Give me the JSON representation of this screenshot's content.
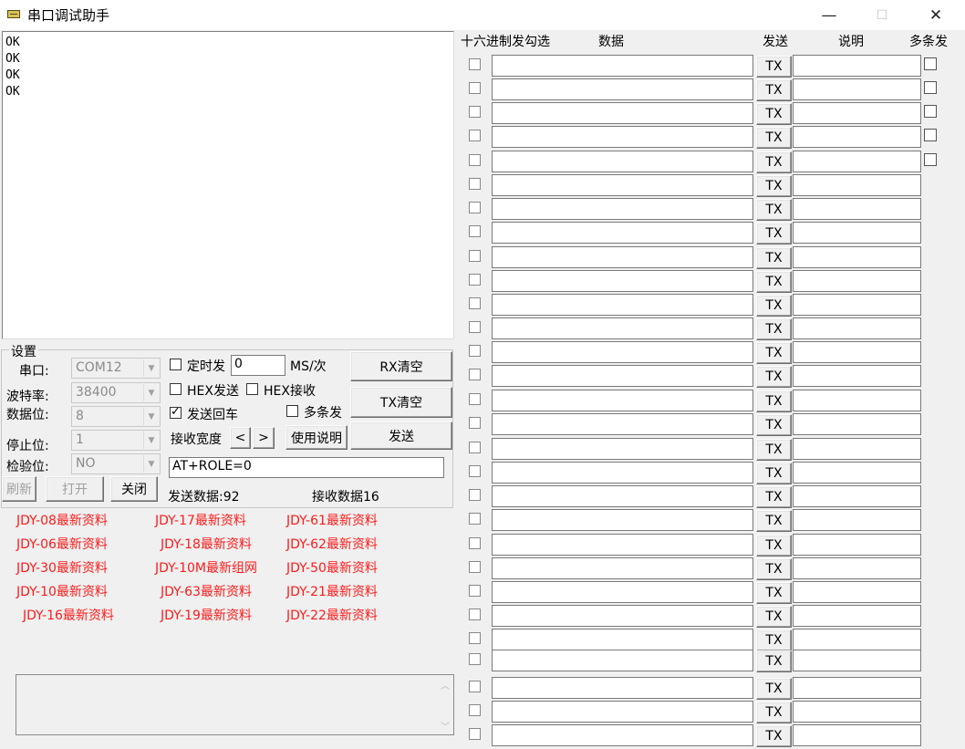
{
  "window": {
    "title": "串口调试助手",
    "minimize": "—",
    "maximize": "☐",
    "close": "✕"
  },
  "receive": {
    "text": "OK\nOK\nOK\nOK"
  },
  "settings": {
    "group_title": "设置",
    "port_label": "串口:",
    "port_value": "COM12",
    "baud_label": "波特率:",
    "baud_value": "38400",
    "databits_label": "数据位:",
    "databits_value": "8",
    "stopbits_label": "停止位:",
    "stopbits_value": "1",
    "parity_label": "检验位:",
    "parity_value": "NO",
    "timed_send_label": "定时发",
    "timed_send_value": "0",
    "interval_unit": "MS/次",
    "hex_send_label": "HEX发送",
    "hex_recv_label": "HEX接收",
    "send_newline_label": "发送回车",
    "multi_send_label": "多条发",
    "recv_width_label": "接收宽度",
    "prev_label": "<",
    "next_label": ">",
    "help_button": "使用说明",
    "rx_clear_button": "RX清空",
    "tx_clear_button": "TX清空",
    "send_button": "发送",
    "refresh_button": "刷新",
    "open_button": "打开",
    "close_button": "关闭",
    "send_input_value": "AT+ROLE=0",
    "sent_count": "发送数据:92",
    "recv_count": "接收数据16"
  },
  "links": [
    [
      "JDY-08最新资料",
      "JDY-17最新资料",
      "JDY-61最新资料"
    ],
    [
      "JDY-06最新资料",
      "JDY-18最新资料",
      "JDY-62最新资料"
    ],
    [
      "JDY-30最新资料",
      "JDY-10M最新组网",
      "JDY-50最新资料"
    ],
    [
      "JDY-10最新资料",
      "JDY-63最新资料",
      "JDY-21最新资料"
    ],
    [
      "JDY-16最新资料",
      "JDY-19最新资料",
      "JDY-22最新资料"
    ]
  ],
  "grid": {
    "headers": {
      "hex": "十六进制发勾选",
      "data": "数据",
      "send": "发送",
      "desc": "说明",
      "multi": "多条发"
    },
    "tx_label": "TX"
  },
  "colors": {
    "link": "#ff1a1a",
    "background": "#f0f0f0"
  },
  "icons": {
    "app": "serial-port-icon",
    "scroll_up": "chevron-up-icon",
    "scroll_down": "chevron-down-icon"
  }
}
